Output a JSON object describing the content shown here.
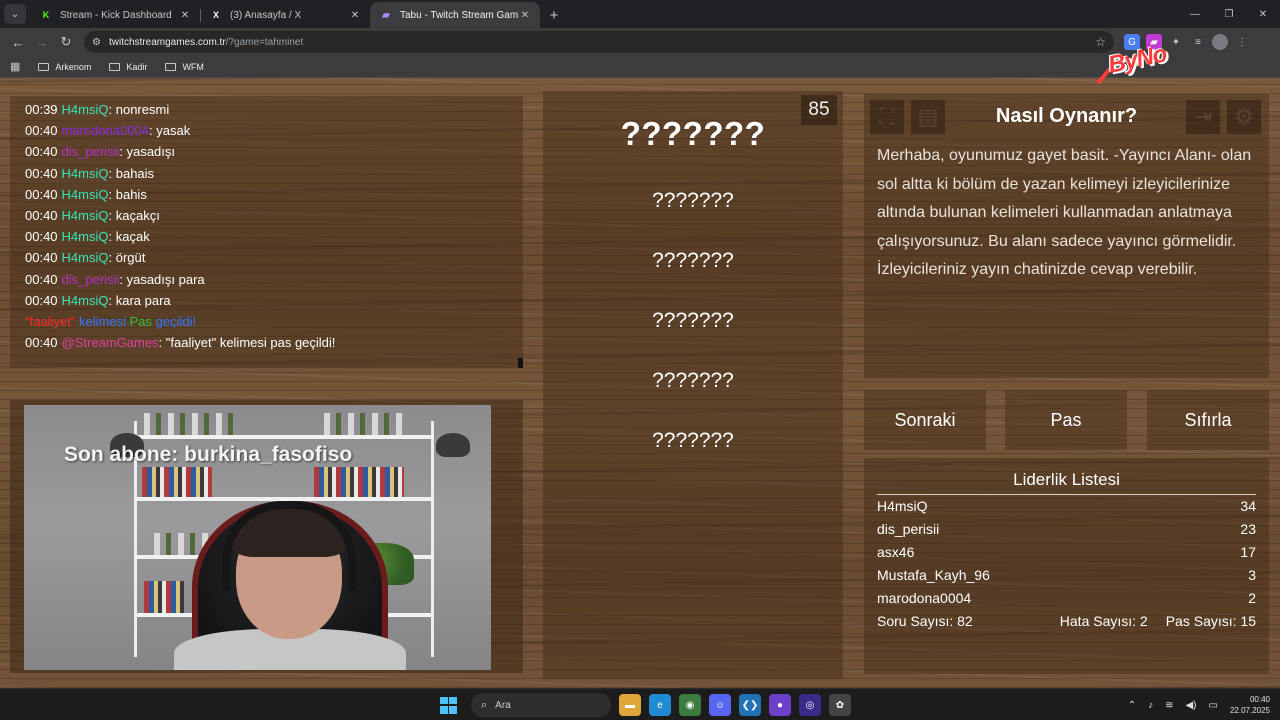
{
  "browser": {
    "tabs": [
      {
        "title": "Stream - Kick Dashboard",
        "favicon": "K",
        "active": false
      },
      {
        "title": "(3) Anasayfa / X",
        "favicon": "X",
        "active": false
      },
      {
        "title": "Tabu - Twitch Stream Games",
        "favicon": "tw",
        "active": true
      }
    ],
    "url_host": "twitchstreamgames.com.tr",
    "url_path": "/?game=tahminet",
    "bookmarks": [
      "Arkenom",
      "Kadir",
      "WFM"
    ]
  },
  "chat": {
    "messages": [
      {
        "time": "00:39",
        "user": "H4msiQ",
        "text": "nonresmi"
      },
      {
        "time": "00:40",
        "user": "marodona0004",
        "text": "yasak"
      },
      {
        "time": "00:40",
        "user": "dis_perisii",
        "text": "yasadışı"
      },
      {
        "time": "00:40",
        "user": "H4msiQ",
        "text": "bahais"
      },
      {
        "time": "00:40",
        "user": "H4msiQ",
        "text": "bahis"
      },
      {
        "time": "00:40",
        "user": "H4msiQ",
        "text": "kaçakçı"
      },
      {
        "time": "00:40",
        "user": "H4msiQ",
        "text": "kaçak"
      },
      {
        "time": "00:40",
        "user": "H4msiQ",
        "text": "örgüt"
      },
      {
        "time": "00:40",
        "user": "dis_perisii",
        "text": "yasadışı para"
      },
      {
        "time": "00:40",
        "user": "H4msiQ",
        "text": "kara para"
      }
    ],
    "system_notice": {
      "word": "\"faaliyet\"",
      "part1": "kelimesi",
      "part2": "Pas",
      "part3": "geçildi!"
    },
    "bot_message": {
      "time": "00:40",
      "user": "@StreamGames",
      "text": "\"faaliyet\" kelimesi pas geçildi!"
    }
  },
  "webcam": {
    "overlay_text": "Son abone: burkina_fasofiso"
  },
  "card": {
    "timer": "85",
    "main_word": "???????",
    "taboo_words": [
      "???????",
      "???????",
      "???????",
      "???????",
      "???????"
    ]
  },
  "info": {
    "title": "Nasıl Oynanır?",
    "text": "Merhaba, oyunumuz gayet basit. -Yayıncı Alanı- olan sol altta ki bölüm de yazan kelimeyi izleyicilerinize altında bulunan kelimeleri kullanmadan anlatmaya çalışıyorsunuz. Bu alanı sadece yayıncı görmelidir. İzleyicileriniz yayın chatinizde cevap verebilir."
  },
  "actions": {
    "next": "Sonraki",
    "pass": "Pas",
    "reset": "Sıfırla"
  },
  "leaderboard": {
    "title": "Liderlik Listesi",
    "rows": [
      {
        "name": "H4msiQ",
        "score": "34"
      },
      {
        "name": "dis_perisii",
        "score": "23"
      },
      {
        "name": "asx46",
        "score": "17"
      },
      {
        "name": "Mustafa_Kayh_96",
        "score": "3"
      },
      {
        "name": "marodona0004",
        "score": "2"
      }
    ],
    "question_count": "Soru Sayısı: 82",
    "error_count": "Hata Sayısı: 2",
    "pass_count": "Pas Sayısı: 15"
  },
  "logo_text": "ByNo",
  "taskbar": {
    "search_placeholder": "Ara",
    "time": "00:40",
    "date": "22.07.2025"
  },
  "colors": {
    "user_h4msiq": "#35e6b8",
    "user_marodona": "#8a2be2",
    "user_dis_perisii": "#b233c4",
    "user_streamgames": "#e040a0"
  }
}
